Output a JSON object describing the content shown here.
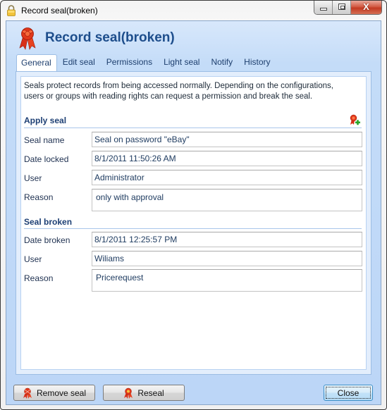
{
  "window": {
    "title": "Record seal(broken)",
    "icon": "lock-icon",
    "controls": {
      "minimize_icon": "minimize-icon",
      "maximize_icon": "maximize-icon",
      "close_glyph": "X"
    }
  },
  "header": {
    "title": "Record seal(broken)",
    "icon": "seal-ribbon-icon"
  },
  "tabs": [
    {
      "label": "General",
      "active": true
    },
    {
      "label": "Edit seal",
      "active": false
    },
    {
      "label": "Permissions",
      "active": false
    },
    {
      "label": "Light seal",
      "active": false
    },
    {
      "label": "Notify",
      "active": false
    },
    {
      "label": "History",
      "active": false
    }
  ],
  "general": {
    "intro_line1": "Seals protect records from being accessed normally. Depending on the configurations,",
    "intro_line2": "users or groups with reading rights can request a permission and break the seal.",
    "apply_seal": {
      "title": "Apply seal",
      "add_icon": "add-seal-icon",
      "fields": {
        "seal_name": {
          "label": "Seal name",
          "value": "Seal on password \"eBay\""
        },
        "date_locked": {
          "label": "Date locked",
          "value": "8/1/2011 11:50:26 AM"
        },
        "user": {
          "label": "User",
          "value": "Administrator"
        },
        "reason": {
          "label": "Reason",
          "value": "only with approval"
        }
      }
    },
    "seal_broken": {
      "title": "Seal broken",
      "fields": {
        "date_broken": {
          "label": "Date broken",
          "value": "8/1/2011 12:25:57 PM"
        },
        "user": {
          "label": "User",
          "value": "Wiliams"
        },
        "reason": {
          "label": "Reason",
          "value": "Pricerequest"
        }
      }
    }
  },
  "footer": {
    "remove_seal_label": "Remove seal",
    "reseal_label": "Reseal",
    "close_label": "Close"
  },
  "colors": {
    "accent_title": "#1e4e8c",
    "section_title": "#1d3f74",
    "seal_red": "#d8301a"
  }
}
